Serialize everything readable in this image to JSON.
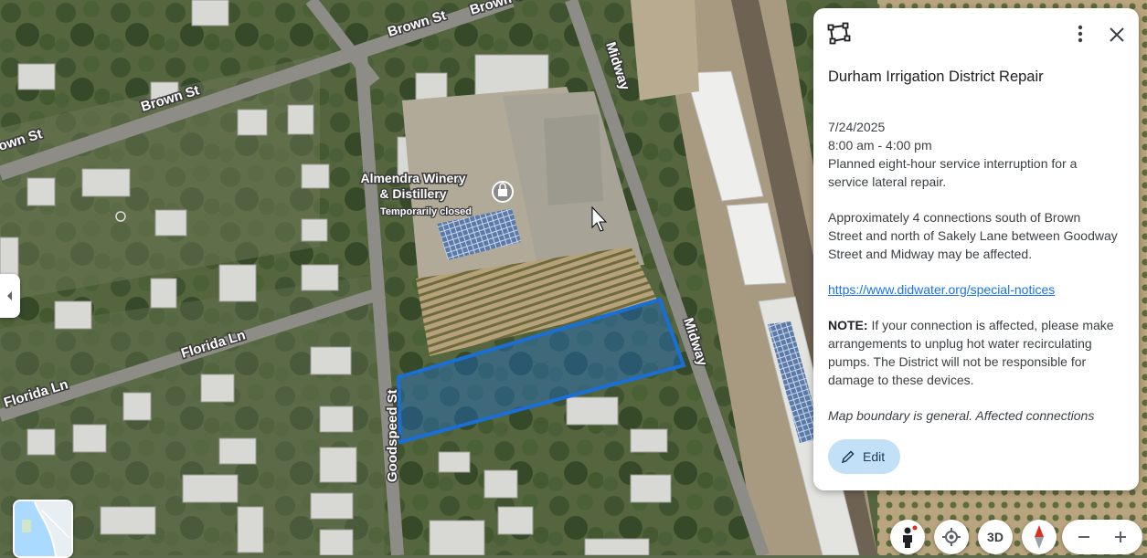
{
  "map": {
    "roads": {
      "brown_st_a": "Brown St",
      "brown_st_b": "Brown St",
      "brown_st_c": "Brown St",
      "brown_st_d": "own St",
      "midway_a": "Midway",
      "midway_b": "Midway",
      "florida_ln_a": "Florida Ln",
      "florida_ln_b": "Florida Ln",
      "goodspeed_st": "Goodspeed St"
    },
    "poi": {
      "name_line1": "Almendra Winery",
      "name_line2": "& Distillery",
      "status": "Temporarily closed"
    },
    "highlight_color": "#1a6fd6"
  },
  "panel": {
    "title": "Durham Irrigation District Repair",
    "date": "7/24/2025",
    "time": "8:00 am - 4:00 pm",
    "desc_line1": "Planned eight-hour service interruption for a",
    "desc_line2": "service lateral repair.",
    "affected_line1": "Approximately 4 connections south of Brown",
    "affected_line2": "Street and north of Sakely Lane between Goodway",
    "affected_line3": "Street and Midway may be affected.",
    "link": "https://www.didwater.org/special-notices",
    "note_label": "NOTE:",
    "note_line1": " If your connection is affected, please make",
    "note_line2": "arrangements to unplug hot water recirculating",
    "note_line3": "pumps. The District will not be responsible for",
    "note_line4": "damage to these devices.",
    "boundary_note": "Map boundary is general. Affected connections",
    "edit_label": "Edit"
  },
  "controls": {
    "three_d_label": "3D",
    "icons": [
      "pegman-icon",
      "my-location-icon",
      "compass-icon",
      "zoom-out-icon",
      "zoom-in-icon"
    ]
  }
}
